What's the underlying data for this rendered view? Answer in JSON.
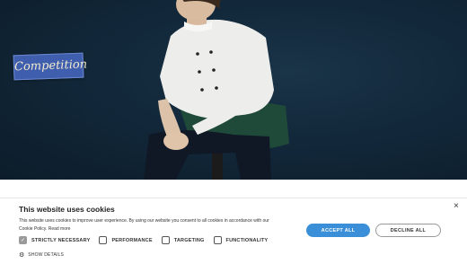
{
  "hero": {
    "badge_text": "Competition"
  },
  "cookie_banner": {
    "title": "This website uses cookies",
    "body_line1": "This website uses cookies to improve user experience. By using our website you consent to all cookies in accordance with our",
    "body_line2": "Cookie Policy.",
    "read_more": "Read more",
    "close_symbol": "×",
    "accept_label": "ACCEPT ALL",
    "decline_label": "DECLINE ALL",
    "options": [
      {
        "label": "STRICTLY NECESSARY",
        "checked": true
      },
      {
        "label": "PERFORMANCE",
        "checked": false
      },
      {
        "label": "TARGETING",
        "checked": false
      },
      {
        "label": "FUNCTIONALITY",
        "checked": false
      }
    ],
    "show_details": "SHOW DETAILS",
    "accent_color": "#3a8fd8"
  }
}
